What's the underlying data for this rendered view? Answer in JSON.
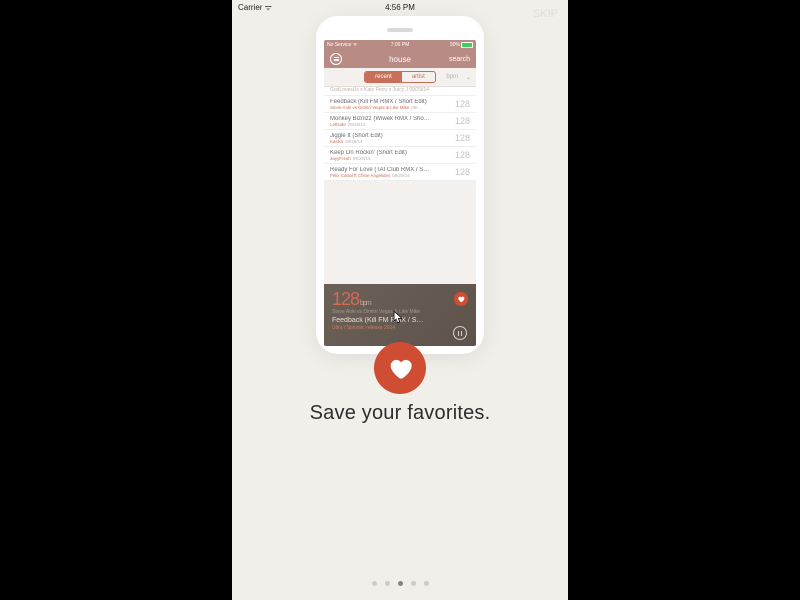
{
  "outer_statusbar": {
    "carrier": "Carrier ᯤ",
    "time": "4:56 PM"
  },
  "skip": "SKIP",
  "phone": {
    "statusbar": {
      "left": "No Service ᯤ",
      "time": "7:06 PM",
      "pct": "90%"
    },
    "nav": {
      "title": "house",
      "search": "search"
    },
    "seg": {
      "left": "recent",
      "right": "artist",
      "bpm": "bpm"
    },
    "tracks": [
      {
        "title": "GodLovesUs x Katy Perry x Juicy J",
        "artist": "",
        "date": "09/29/14",
        "bpm": ""
      },
      {
        "title": "Feedback (Kill FM RMX / Short Edit)",
        "artist": "Steve Aoki vs Dimitri Vegas & Like Mike",
        "date": "09/…",
        "bpm": "128"
      },
      {
        "title": "Monkey Biznizz (Wiwek RMX / Sho…",
        "artist": "Leftside",
        "date": "09/29/14",
        "bpm": "128"
      },
      {
        "title": "Jiggle It (Short Edit)",
        "artist": "Kastra",
        "date": "09/29/14",
        "bpm": "128"
      },
      {
        "title": "Keep On Rockin' (Short Edit)",
        "artist": "JayyFresh",
        "date": "09/29/14",
        "bpm": "128"
      },
      {
        "title": "Ready For Love (TAI Club RMX / S…",
        "artist": "Felix Cartal ft Chloe Angelides",
        "date": "09/29/14",
        "bpm": "128"
      }
    ],
    "player": {
      "bpm": "128",
      "bpm_unit": "bpm",
      "sub": "Steve Aoki vs Dimitri Vegas & Like Mike",
      "title": "Feedback (Kill FM RMX / S…",
      "label": "Ultra / Spinnin; release 2014"
    }
  },
  "hero_text": "Save your favorites.",
  "page_dots": {
    "count": 5,
    "active": 2
  }
}
